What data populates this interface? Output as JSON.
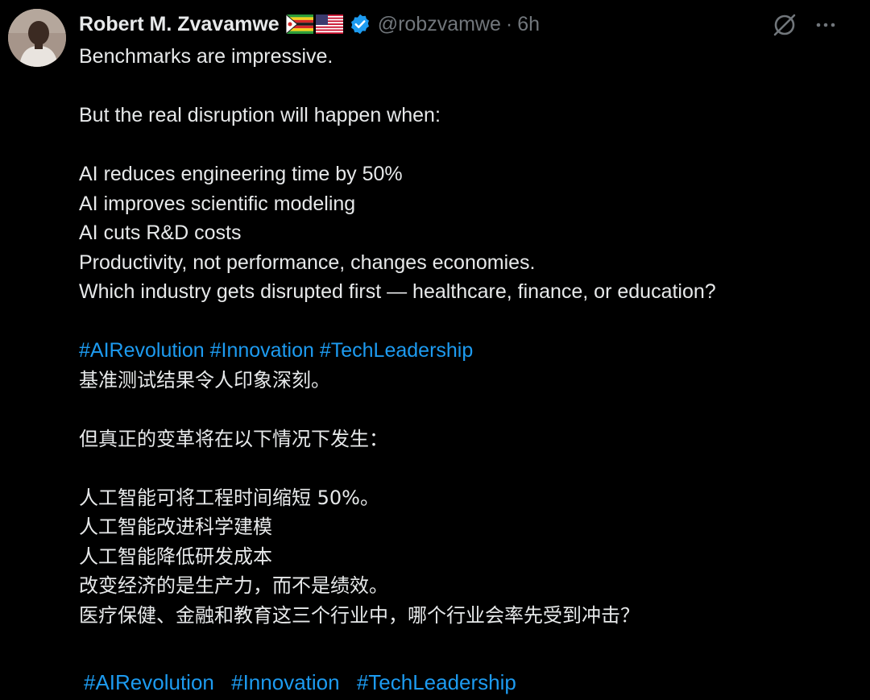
{
  "author": {
    "display_name": "Robert M. Zvavamwe",
    "handle": "@robzvamwe",
    "separator": "·",
    "time": "6h",
    "flags": [
      "zimbabwe-flag",
      "usa-flag"
    ],
    "verified": true
  },
  "icons": {
    "grok": "grok-icon",
    "more": "more-icon",
    "verified": "verified-badge-icon"
  },
  "colors": {
    "background": "#000000",
    "text": "#e7e9ea",
    "muted": "#71767b",
    "link": "#1d9bf0"
  },
  "post": {
    "en": {
      "line1": "Benchmarks are impressive.",
      "line2": "But the real disruption will happen when:",
      "line3": "AI reduces engineering time by 50%",
      "line4": "AI improves scientific modeling",
      "line5": "AI cuts R&D costs",
      "line6": "Productivity, not performance, changes economies.",
      "line7": "Which industry gets disrupted first — healthcare, finance, or education?",
      "hashtags": [
        "#AIRevolution",
        "#Innovation",
        "#TechLeadership"
      ]
    },
    "zh": {
      "line1": "基准测试结果令人印象深刻。",
      "line2": "但真正的变革将在以下情况下发生：",
      "line3": "人工智能可将工程时间缩短 50%。",
      "line4": "人工智能改进科学建模",
      "line5": "人工智能降低研发成本",
      "line6": "改变经济的是生产力，而不是绩效。",
      "line7": "医疗保健、金融和教育这三个行业中，哪个行业会率先受到冲击？",
      "hashtags": [
        "#AIRevolution",
        "#Innovation",
        "#TechLeadership"
      ]
    }
  }
}
